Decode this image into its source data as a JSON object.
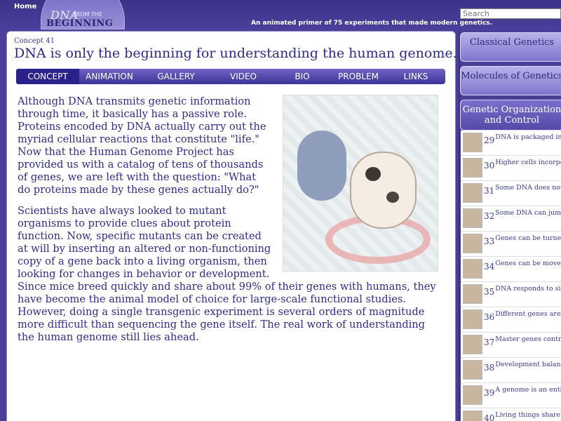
{
  "header": {
    "home_label": "Home",
    "logo": {
      "line1": "DNA",
      "from": "FROM THE",
      "line2": "BEGINNING"
    },
    "tagline": "An animated primer of 75 experiments that made modern genetics.",
    "search_placeholder": "Search"
  },
  "concept": {
    "label": "Concept 41",
    "title": "DNA is only the beginning for understanding the human genome."
  },
  "tabs": [
    {
      "label": "CONCEPT",
      "active": true
    },
    {
      "label": "ANIMATION"
    },
    {
      "label": "GALLERY"
    },
    {
      "label": "VIDEO"
    },
    {
      "label": "BIO"
    },
    {
      "label": "PROBLEM"
    },
    {
      "label": "LINKS"
    }
  ],
  "body": {
    "p1": "Although DNA transmits genetic information through time, it basically has a passive role. Proteins encoded by DNA actually carry out the myriad cellular reactions that constitute \"life.\" Now that the Human Genome Project has provided us with a catalog of tens of thousands of genes, we are left with the question: \"What do proteins made by these genes actually do?\"",
    "p2": "Scientists have always looked to mutant organisms to provide clues about protein function. Now, specific mutants can be created at will by inserting an altered or non-functioning copy of a gene back into a living organism, then looking for changes in behavior or development. Since mice breed quickly and share about 99% of their genes with humans, they have become the animal model of choice for large-scale functional studies. However, doing a single transgenic experiment is several orders of magnitude more difficult than sequencing the gene itself. The real work of understanding the human genome still lies ahead."
  },
  "sidebar": {
    "sections": [
      {
        "label": "Classical Genetics"
      },
      {
        "label": "Molecules of Genetics"
      },
      {
        "label": "Genetic Organization and Control"
      }
    ],
    "items": [
      {
        "num": "29",
        "text": "DNA is packaged in a chromosome."
      },
      {
        "num": "30",
        "text": "Higher cells incorporat ancient chromosome."
      },
      {
        "num": "31",
        "text": "Some DNA does not en protein."
      },
      {
        "num": "32",
        "text": "Some DNA can jump."
      },
      {
        "num": "33",
        "text": "Genes can be turned o off."
      },
      {
        "num": "34",
        "text": "Genes can be moved between species."
      },
      {
        "num": "35",
        "text": "DNA responds to signa from outside the cell."
      },
      {
        "num": "36",
        "text": "Different genes are act in different kinds of ce"
      },
      {
        "num": "37",
        "text": "Master genes control b body plans."
      },
      {
        "num": "38",
        "text": "Development balances growth and death."
      },
      {
        "num": "39",
        "text": "A genome is an entire s genes."
      },
      {
        "num": "40",
        "text": "Living things share"
      }
    ]
  },
  "colors": {
    "brand": "#4a3f96",
    "text": "#2f2c8a",
    "tab_active": "#2a218a"
  }
}
